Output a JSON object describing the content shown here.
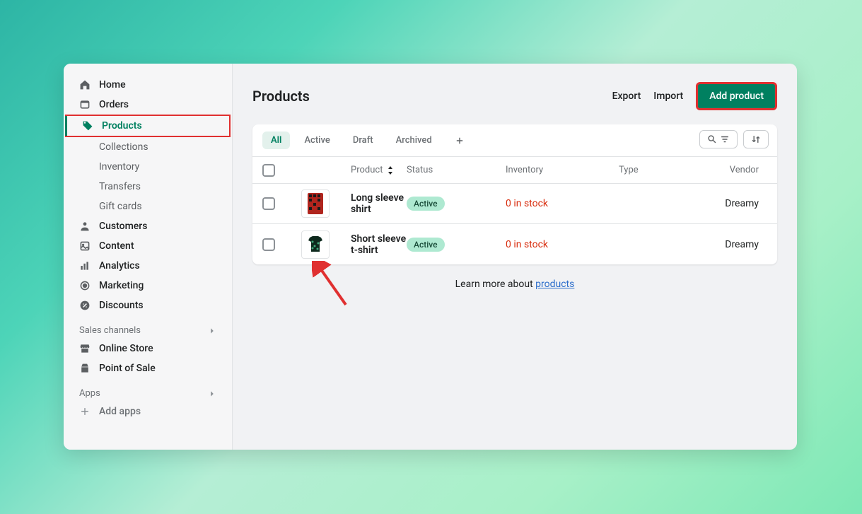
{
  "page_title": "Products",
  "header_actions": {
    "export": "Export",
    "import": "Import",
    "add_product": "Add product"
  },
  "sidebar": {
    "items": [
      {
        "label": "Home"
      },
      {
        "label": "Orders"
      },
      {
        "label": "Products"
      },
      {
        "label": "Customers"
      },
      {
        "label": "Content"
      },
      {
        "label": "Analytics"
      },
      {
        "label": "Marketing"
      },
      {
        "label": "Discounts"
      }
    ],
    "product_subs": [
      {
        "label": "Collections"
      },
      {
        "label": "Inventory"
      },
      {
        "label": "Transfers"
      },
      {
        "label": "Gift cards"
      }
    ],
    "sales_channels_label": "Sales channels",
    "channels": [
      {
        "label": "Online Store"
      },
      {
        "label": "Point of Sale"
      }
    ],
    "apps_label": "Apps",
    "add_apps_label": "Add apps"
  },
  "tabs": {
    "all": "All",
    "active": "Active",
    "draft": "Draft",
    "archived": "Archived"
  },
  "columns": {
    "product": "Product",
    "status": "Status",
    "inventory": "Inventory",
    "type": "Type",
    "vendor": "Vendor"
  },
  "rows": [
    {
      "name": "Long sleeve shirt",
      "status": "Active",
      "inventory": "0 in stock",
      "type": "",
      "vendor": "Dreamy"
    },
    {
      "name": "Short sleeve t-shirt",
      "status": "Active",
      "inventory": "0 in stock",
      "type": "",
      "vendor": "Dreamy"
    }
  ],
  "learn_more_prefix": "Learn more about ",
  "learn_more_link": "products"
}
